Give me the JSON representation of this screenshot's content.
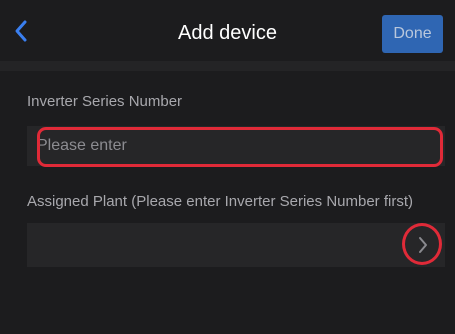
{
  "navbar": {
    "back_icon": "chevron-left-icon",
    "title": "Add device",
    "done_label": "Done"
  },
  "form": {
    "serial_label": "Inverter Series Number",
    "serial_placeholder": "Please enter",
    "serial_value": "",
    "plant_label": "Assigned Plant (Please enter Inverter Series Number first)",
    "plant_value": "",
    "plant_arrow_icon": "chevron-right-icon"
  },
  "colors": {
    "background": "#1c1c1e",
    "field": "#262628",
    "accent": "#2f66b3",
    "back_icon": "#3a7ff0",
    "highlight": "#e02a38"
  }
}
